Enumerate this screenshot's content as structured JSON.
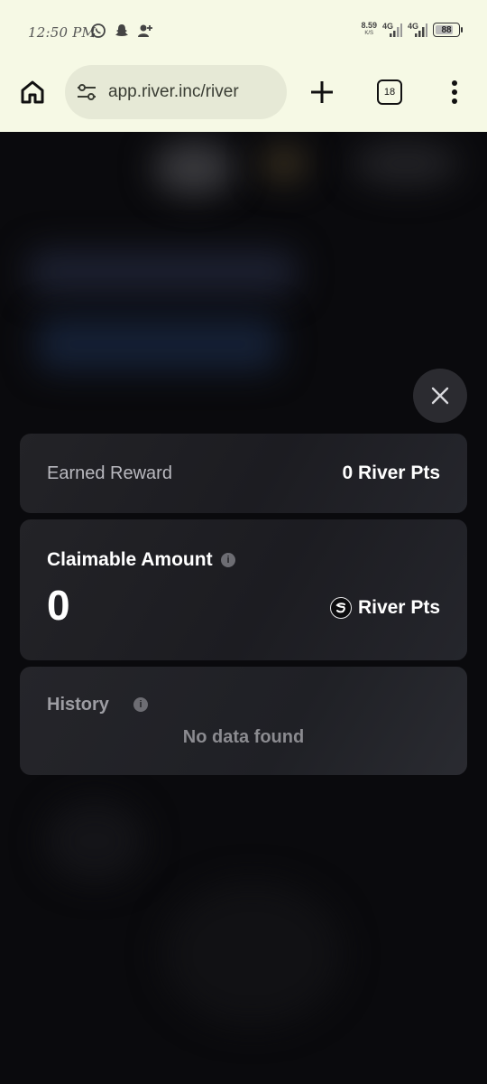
{
  "status_bar": {
    "time": "12:50 PM",
    "net_speed": "8.59",
    "net_speed_unit": "K/S",
    "signal_1": "4G",
    "signal_2": "4G",
    "battery": "88"
  },
  "browser": {
    "url": "app.river.inc/river",
    "tab_count": "18"
  },
  "rewards": {
    "earned_label": "Earned Reward",
    "earned_value": "0 River Pts",
    "claim_label": "Claimable Amount",
    "claim_amount": "0",
    "claim_unit": "River Pts",
    "history_label": "History",
    "history_empty": "No data found"
  },
  "icons": {
    "home": "home-icon",
    "tune": "tune-icon",
    "add": "plus-icon",
    "menu": "more-vert-icon",
    "close": "close-icon",
    "info": "info-icon",
    "logo": "river-logo-icon"
  }
}
